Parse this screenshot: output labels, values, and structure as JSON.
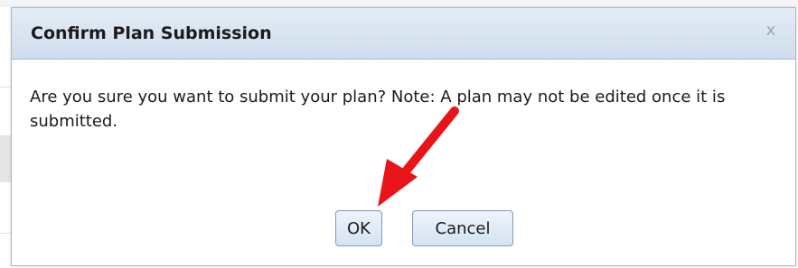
{
  "dialog": {
    "title": "Confirm Plan Submission",
    "close_label": "x",
    "message": "Are you sure you want to submit your plan? Note: A plan may not be edited once it is submitted.",
    "buttons": {
      "ok_label": "OK",
      "cancel_label": "Cancel"
    }
  },
  "annotation": {
    "arrow_color": "#e8141a",
    "target": "OK"
  },
  "colors": {
    "titlebar": "#dbe6f2",
    "border": "#a9b8c8",
    "button_border": "#7f9db9"
  }
}
